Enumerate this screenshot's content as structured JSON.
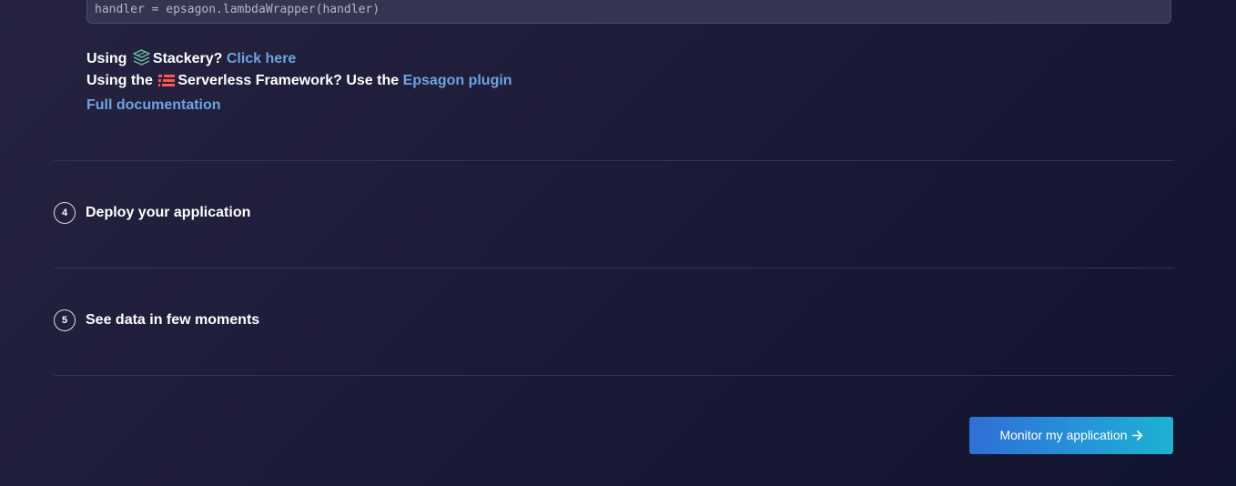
{
  "code": {
    "snippet": "handler = epsagon.lambdaWrapper(handler)"
  },
  "links": {
    "stackery": {
      "prefix": "Using ",
      "name": "Stackery? ",
      "link": "Click here",
      "icon": "stackery-logo-icon"
    },
    "serverless": {
      "prefix": "Using the ",
      "name": "Serverless Framework? Use the ",
      "link": "Epsagon plugin",
      "icon": "serverless-logo-icon"
    },
    "docs": "Full documentation"
  },
  "steps": [
    {
      "number": "4",
      "title": "Deploy your application"
    },
    {
      "number": "5",
      "title": "See data in few moments"
    }
  ],
  "cta": {
    "label": "Monitor my application",
    "icon": "arrow-right-icon"
  },
  "colors": {
    "link": "#6ea4e0",
    "button_start": "#2f6fd6",
    "button_end": "#1cb3cf",
    "serverless_red": "#fd5750",
    "stackery_green": "#6fc2a0"
  }
}
